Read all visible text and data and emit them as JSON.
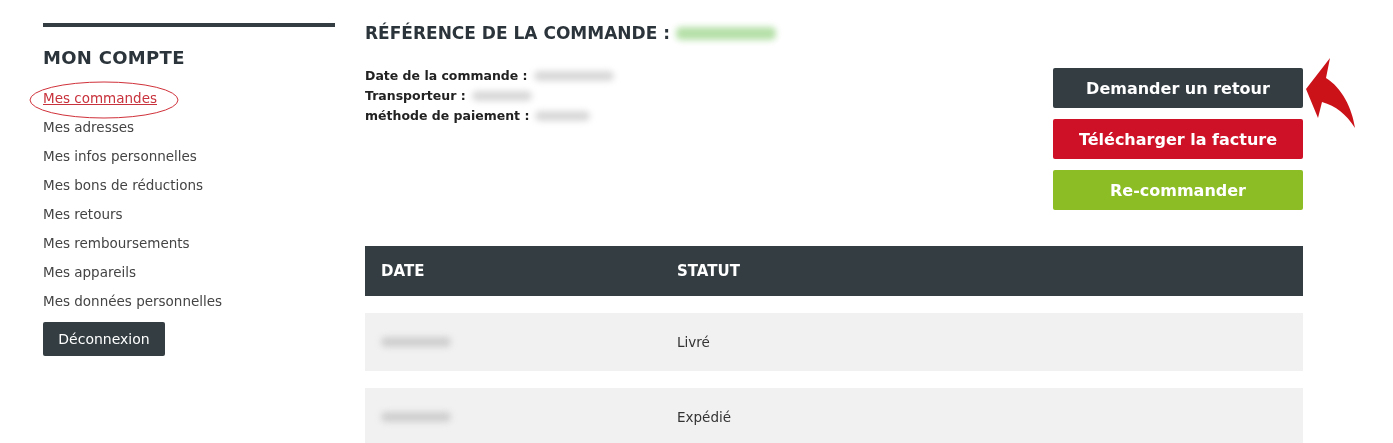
{
  "sidebar": {
    "title": "MON COMPTE",
    "items": [
      {
        "label": "Mes commandes",
        "selected": true
      },
      {
        "label": "Mes adresses",
        "selected": false
      },
      {
        "label": "Mes infos personnelles",
        "selected": false
      },
      {
        "label": "Mes bons de réductions",
        "selected": false
      },
      {
        "label": "Mes retours",
        "selected": false
      },
      {
        "label": "Mes remboursements",
        "selected": false
      },
      {
        "label": "Mes appareils",
        "selected": false
      },
      {
        "label": "Mes données personnelles",
        "selected": false
      }
    ],
    "logout_button": "Déconnexion"
  },
  "order": {
    "title": "RÉFÉRENCE DE LA COMMANDE :",
    "details": [
      {
        "label": "Date de la commande :"
      },
      {
        "label": "Transporteur :"
      },
      {
        "label": "méthode de paiement :"
      }
    ],
    "buttons": [
      {
        "label": "Demander un retour",
        "color": "#333d42"
      },
      {
        "label": "Télécharger la facture",
        "color": "#ce1126"
      },
      {
        "label": "Re-commander",
        "color": "#8cbd24"
      }
    ]
  },
  "table": {
    "columns": [
      "DATE",
      "STATUT"
    ],
    "rows": [
      {
        "status": "Livré"
      },
      {
        "status": "Expédié"
      }
    ]
  }
}
